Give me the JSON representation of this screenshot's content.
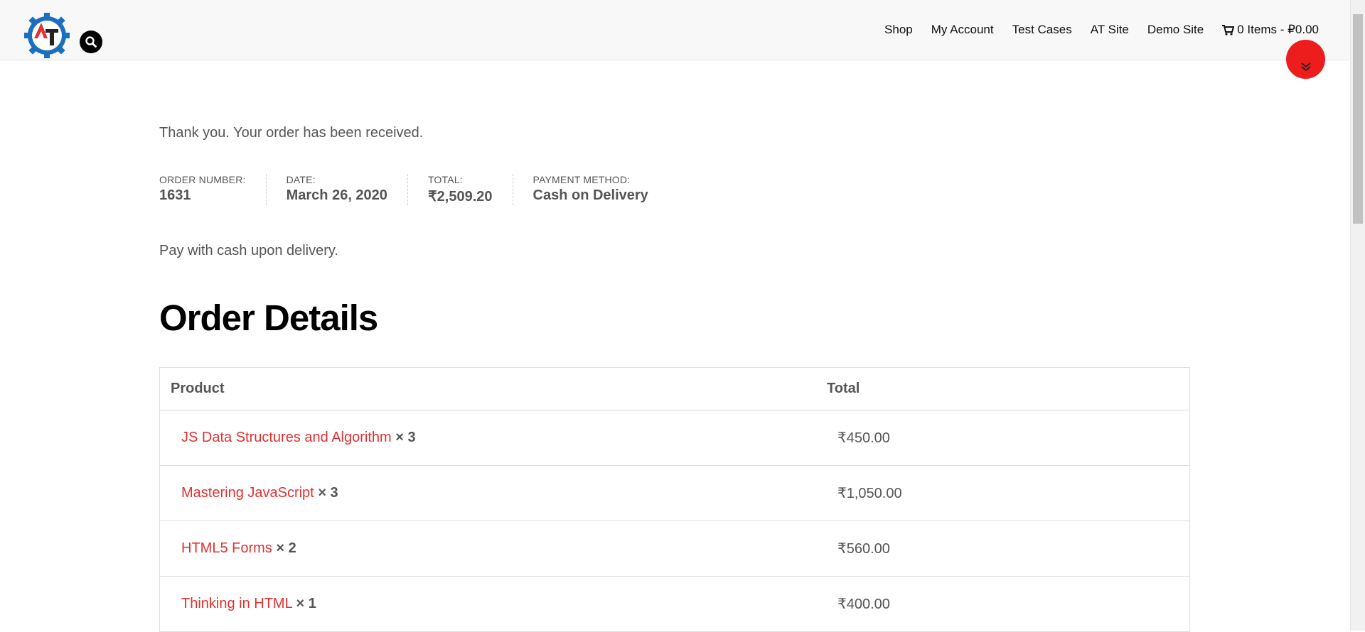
{
  "header": {
    "nav": [
      {
        "label": "Shop"
      },
      {
        "label": "My Account"
      },
      {
        "label": "Test Cases"
      },
      {
        "label": "AT Site"
      },
      {
        "label": "Demo Site"
      }
    ],
    "cart": {
      "label": "0 Items - ₽0.00",
      "icon": "cart-icon"
    },
    "search_icon": "search-icon",
    "logo_text": "AT"
  },
  "colors": {
    "accent": "#e03131",
    "float_button": "#ee1d1d",
    "logo_blue": "#1a6fbf"
  },
  "notice": "Thank you. Your order has been received.",
  "overview": [
    {
      "label": "ORDER NUMBER:",
      "value": "1631"
    },
    {
      "label": "DATE:",
      "value": "March 26, 2020"
    },
    {
      "label": "TOTAL:",
      "value": "₹2,509.20"
    },
    {
      "label": "PAYMENT METHOD:",
      "value": "Cash on Delivery"
    }
  ],
  "pay_note": "Pay with cash upon delivery.",
  "details_title": "Order Details",
  "table": {
    "headers": {
      "product": "Product",
      "total": "Total"
    },
    "rows": [
      {
        "product": "JS Data Structures and Algorithm",
        "qty": "× 3",
        "total": "₹450.00"
      },
      {
        "product": "Mastering JavaScript",
        "qty": "× 3",
        "total": "₹1,050.00"
      },
      {
        "product": "HTML5 Forms",
        "qty": "× 2",
        "total": "₹560.00"
      },
      {
        "product": "Thinking in HTML",
        "qty": "× 1",
        "total": "₹400.00"
      }
    ]
  }
}
